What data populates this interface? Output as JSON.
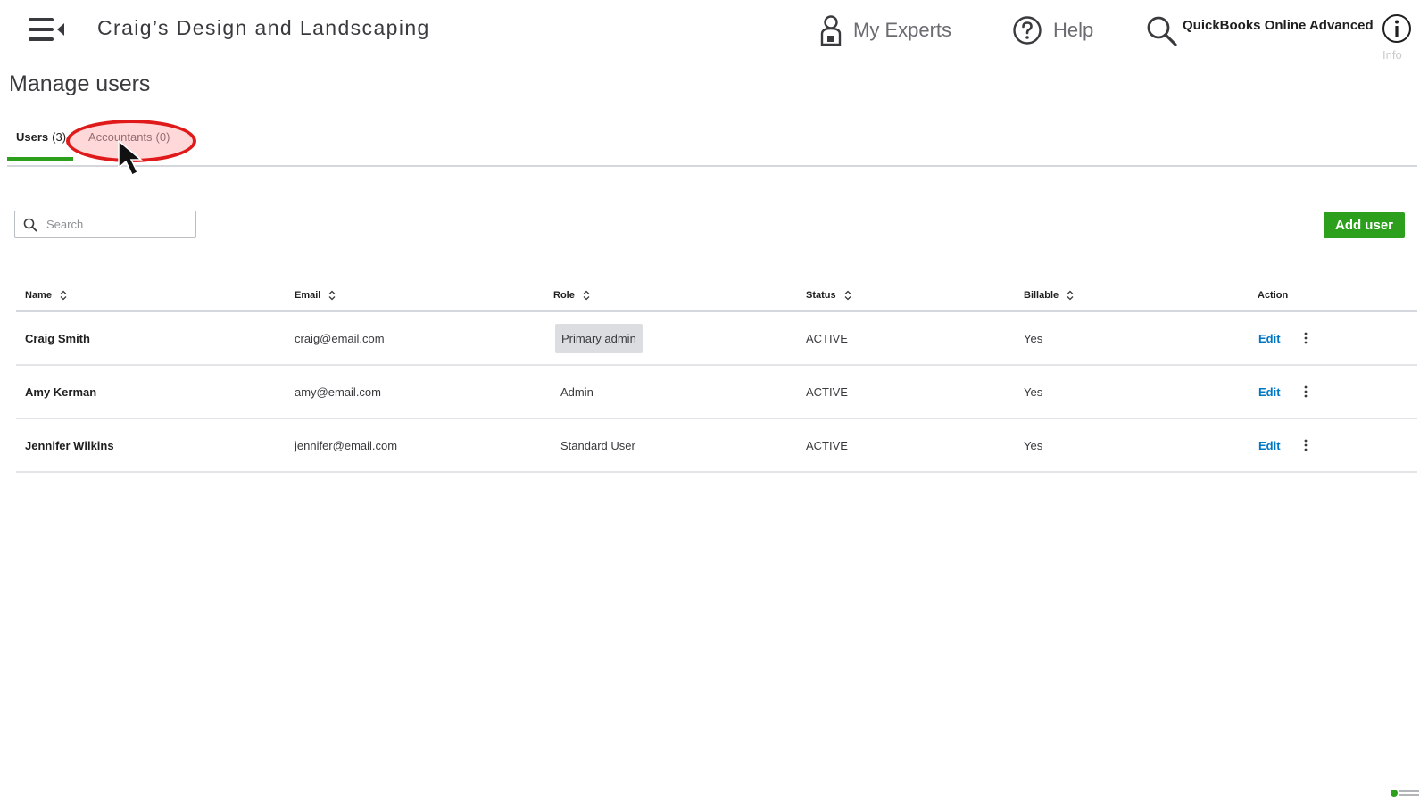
{
  "header": {
    "company_name": "Craig’s Design and Landscaping",
    "my_experts_label": "My Experts",
    "help_label": "Help",
    "product_name": "QuickBooks Online Advanced",
    "info_label": "Info"
  },
  "page": {
    "title": "Manage users"
  },
  "tabs": [
    {
      "label": "Users",
      "count": "(3)",
      "active": true
    },
    {
      "label": "Accountants",
      "count": "(0)",
      "active": false
    }
  ],
  "search": {
    "placeholder": "Search",
    "value": ""
  },
  "add_user_label": "Add user",
  "table": {
    "columns": [
      "Name",
      "Email",
      "Role",
      "Status",
      "Billable",
      "Action"
    ],
    "rows": [
      {
        "name": "Craig Smith",
        "email": "craig@email.com",
        "role": "Primary admin",
        "status": "ACTIVE",
        "billable": "Yes",
        "action": "Edit"
      },
      {
        "name": "Amy Kerman",
        "email": "amy@email.com",
        "role": "Admin",
        "status": "ACTIVE",
        "billable": "Yes",
        "action": "Edit"
      },
      {
        "name": "Jennifer Wilkins",
        "email": "jennifer@email.com",
        "role": "Standard User",
        "status": "ACTIVE",
        "billable": "Yes",
        "action": "Edit"
      }
    ]
  },
  "colors": {
    "brand_green": "#2ca01c",
    "link_blue": "#0077c5",
    "highlight_red": "#e01a1a"
  },
  "icons": [
    "hamburger-menu-icon",
    "lock-person-icon",
    "help-circle-icon",
    "search-icon",
    "info-icon",
    "sort-icon",
    "kebab-menu-icon",
    "mouse-cursor-icon"
  ]
}
